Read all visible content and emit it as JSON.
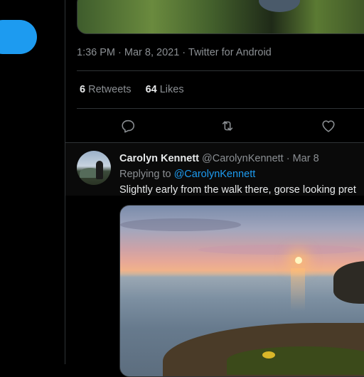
{
  "sidebar": {
    "tweet_button_color": "#1d9bf0"
  },
  "tweet": {
    "timestamp": "1:36 PM · Mar 8, 2021",
    "source": "Twitter for Android",
    "retweets_count": "6",
    "retweets_label": "Retweets",
    "likes_count": "64",
    "likes_label": "Likes",
    "actions": [
      "reply-icon",
      "retweet-icon",
      "like-icon"
    ]
  },
  "reply": {
    "name": "Carolyn Kennett",
    "handle": "@CarolynKennett",
    "date": "Mar 8",
    "replying_prefix": "Replying to",
    "replying_handle": "@CarolynKennett",
    "text": "Slightly early from the walk there, gorse looking pret"
  },
  "colors": {
    "accent": "#1d9bf0",
    "background": "#000000",
    "muted": "#8b8f93"
  }
}
